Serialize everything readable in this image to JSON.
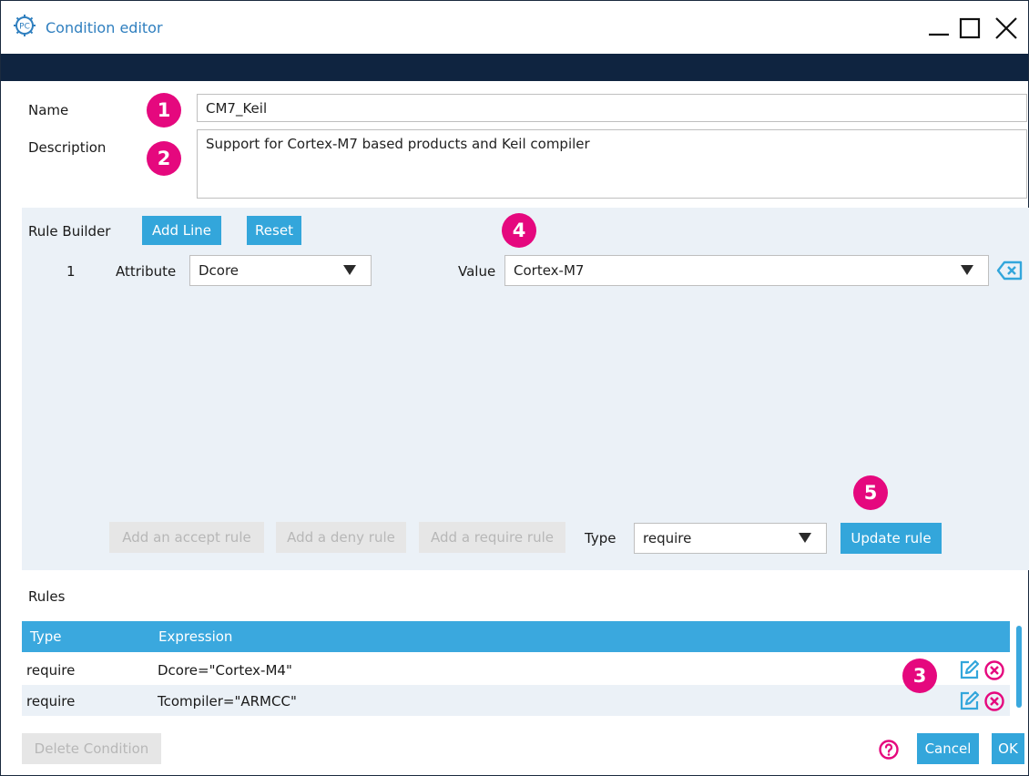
{
  "window": {
    "title": "Condition editor",
    "app_icon_text": "PC"
  },
  "form": {
    "name_label": "Name",
    "name_value": "CM7_Keil",
    "description_label": "Description",
    "description_value": "Support for Cortex-M7 based products and Keil compiler"
  },
  "callouts": [
    "1",
    "2",
    "3",
    "4",
    "5"
  ],
  "rule_builder": {
    "label": "Rule Builder",
    "add_line_label": "Add Line",
    "reset_label": "Reset",
    "line": {
      "number": "1",
      "attribute_label": "Attribute",
      "attribute_value": "Dcore",
      "value_label": "Value",
      "value_value": "Cortex-M7"
    },
    "add_accept_label": "Add an accept rule",
    "add_deny_label": "Add a deny rule",
    "add_require_label": "Add a require rule",
    "type_label": "Type",
    "type_value": "require",
    "update_label": "Update rule"
  },
  "rules": {
    "label": "Rules",
    "columns": [
      "Type",
      "Expression"
    ],
    "rows": [
      {
        "type": "require",
        "expression": "Dcore=\"Cortex-M4\""
      },
      {
        "type": "require",
        "expression": "Tcompiler=\"ARMCC\""
      }
    ]
  },
  "footer": {
    "delete_label": "Delete Condition",
    "cancel_label": "Cancel",
    "ok_label": "OK"
  },
  "colors": {
    "accent": "#33a6db",
    "badge": "#e5087e",
    "title_band": "#0f2440",
    "panel": "#ebf1f7"
  }
}
